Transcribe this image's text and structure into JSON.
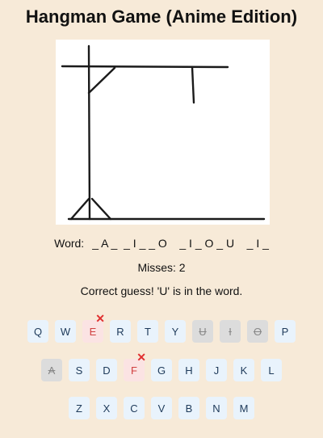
{
  "title": "Hangman Game (Anime Edition)",
  "word": {
    "label": "Word:",
    "display": "_ A _  _ I _ _ O    _ I _ O _ U    _ I _"
  },
  "misses": "Misses: 2",
  "status": "Correct guess! 'U' is in the word.",
  "mark_symbol": "✕",
  "keyboard": {
    "row1": [
      {
        "letter": "Q",
        "state": "available"
      },
      {
        "letter": "W",
        "state": "available"
      },
      {
        "letter": "E",
        "state": "wrong"
      },
      {
        "letter": "R",
        "state": "available"
      },
      {
        "letter": "T",
        "state": "available"
      },
      {
        "letter": "Y",
        "state": "available"
      },
      {
        "letter": "U",
        "state": "used"
      },
      {
        "letter": "I",
        "state": "used"
      },
      {
        "letter": "O",
        "state": "used"
      },
      {
        "letter": "P",
        "state": "available"
      }
    ],
    "row2": [
      {
        "letter": "A",
        "state": "used"
      },
      {
        "letter": "S",
        "state": "available"
      },
      {
        "letter": "D",
        "state": "available"
      },
      {
        "letter": "F",
        "state": "wrong"
      },
      {
        "letter": "G",
        "state": "available"
      },
      {
        "letter": "H",
        "state": "available"
      },
      {
        "letter": "J",
        "state": "available"
      },
      {
        "letter": "K",
        "state": "available"
      },
      {
        "letter": "L",
        "state": "available"
      }
    ],
    "row3": [
      {
        "letter": "Z",
        "state": "available"
      },
      {
        "letter": "X",
        "state": "available"
      },
      {
        "letter": "C",
        "state": "available"
      },
      {
        "letter": "V",
        "state": "available"
      },
      {
        "letter": "B",
        "state": "available"
      },
      {
        "letter": "N",
        "state": "available"
      },
      {
        "letter": "M",
        "state": "available"
      }
    ]
  },
  "colors": {
    "background": "#f7ead8",
    "key": "#e9f3fc",
    "key_wrong": "#fbe3e3",
    "key_used": "#dcdcdc",
    "wrong_mark": "#e03030"
  }
}
